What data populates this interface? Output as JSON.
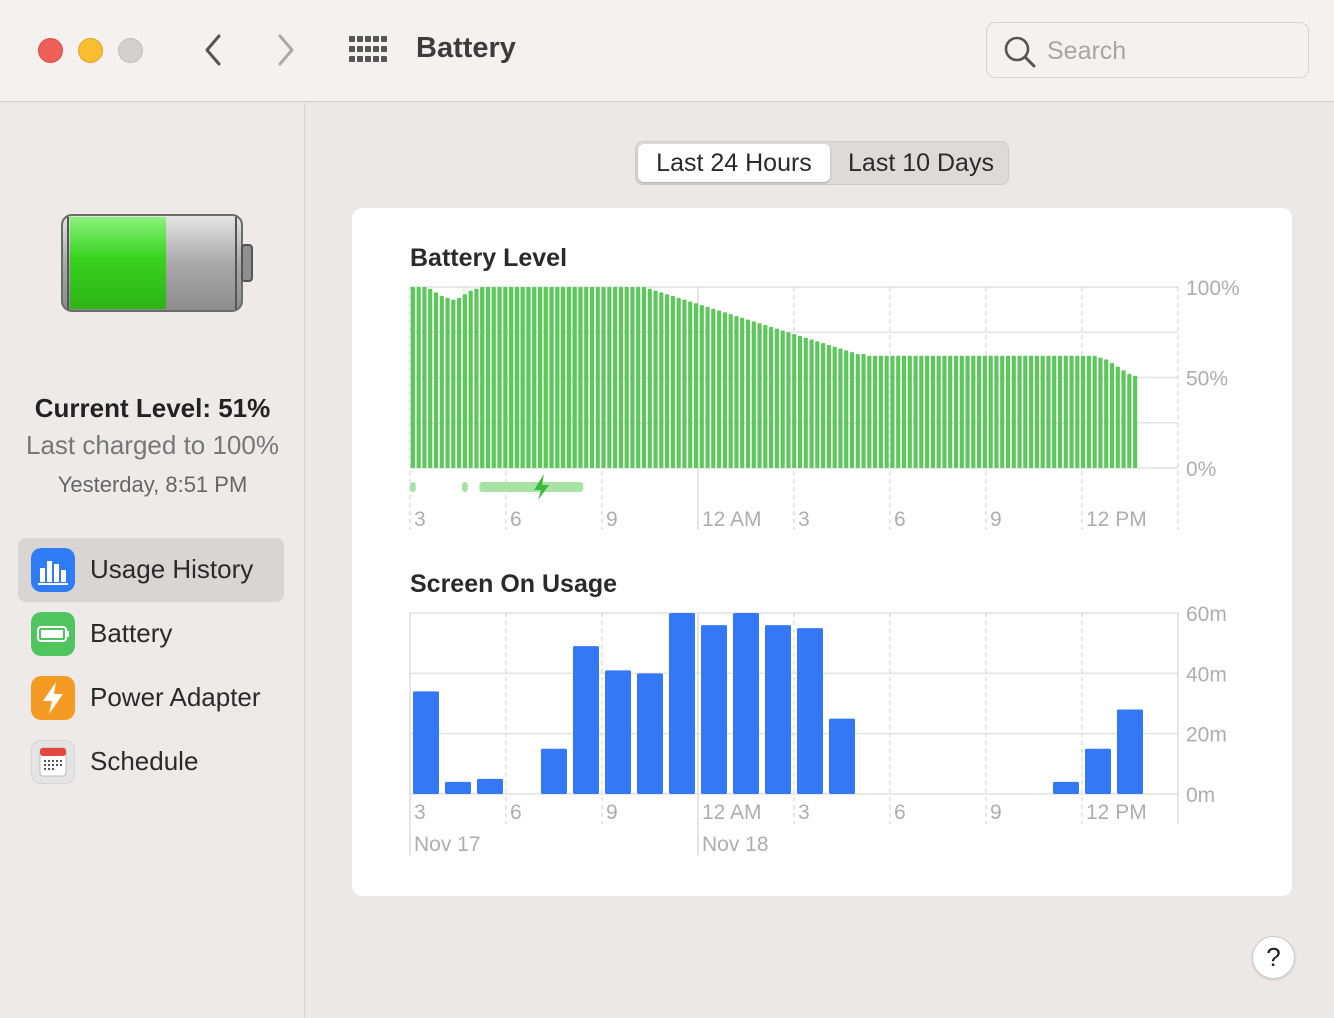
{
  "window": {
    "title": "Battery"
  },
  "search": {
    "placeholder": "Search"
  },
  "sidebar": {
    "current_level": "Current Level: 51%",
    "last_charged": "Last charged to 100%",
    "charged_time": "Yesterday, 8:51 PM",
    "battery_fill_fraction": 0.51,
    "items": [
      {
        "label": "Usage History",
        "icon": "bar-chart-icon",
        "color": "#2f7cf6",
        "active": true
      },
      {
        "label": "Battery",
        "icon": "battery-icon",
        "color": "#4fc45f",
        "active": false
      },
      {
        "label": "Power Adapter",
        "icon": "bolt-icon",
        "color": "#f59a23",
        "active": false
      },
      {
        "label": "Schedule",
        "icon": "calendar-icon",
        "color": "#e8e8e8",
        "active": false
      }
    ]
  },
  "tabs": [
    {
      "label": "Last 24 Hours",
      "selected": true
    },
    {
      "label": "Last 10 Days",
      "selected": false
    }
  ],
  "help_label": "?",
  "colors": {
    "battery_green": "#5cc85b",
    "charging_green": "#a7e4a4",
    "usage_blue": "#3478f6"
  },
  "chart_data": [
    {
      "type": "bar",
      "title": "Battery Level",
      "y_unit": "%",
      "ylim": [
        0,
        100
      ],
      "y_ticks": [
        "100%",
        "50%",
        "0%"
      ],
      "x_ticks": [
        "3",
        "6",
        "9",
        "12 AM",
        "3",
        "6",
        "9",
        "12 PM"
      ],
      "values": [
        100,
        100,
        100,
        99,
        97,
        95,
        94,
        93,
        94,
        96,
        98,
        99,
        100,
        100,
        100,
        100,
        100,
        100,
        100,
        100,
        100,
        100,
        100,
        100,
        100,
        100,
        100,
        100,
        100,
        100,
        100,
        100,
        100,
        100,
        100,
        100,
        100,
        100,
        100,
        100,
        100,
        99,
        98,
        97,
        96,
        95,
        94,
        93,
        92,
        91,
        90,
        89,
        88,
        87,
        86,
        85,
        84,
        83,
        82,
        81,
        80,
        79,
        78,
        77,
        76,
        75,
        74,
        73,
        72,
        71,
        70,
        69,
        68,
        67,
        66,
        65,
        64,
        63,
        63,
        62,
        62,
        62,
        62,
        62,
        62,
        62,
        62,
        62,
        62,
        62,
        62,
        62,
        62,
        62,
        62,
        62,
        62,
        62,
        62,
        62,
        62,
        62,
        62,
        62,
        62,
        62,
        62,
        62,
        62,
        62,
        62,
        62,
        62,
        62,
        62,
        62,
        62,
        62,
        62,
        61,
        60,
        58,
        56,
        54,
        52,
        51
      ],
      "charging_periods": [
        [
          0,
          1
        ],
        [
          9,
          10
        ],
        [
          12,
          30
        ]
      ]
    },
    {
      "type": "bar",
      "title": "Screen On Usage",
      "y_unit": "minutes",
      "ylim": [
        0,
        60
      ],
      "y_ticks": [
        "60m",
        "40m",
        "20m",
        "0m"
      ],
      "x_ticks": [
        "3",
        "6",
        "9",
        "12 AM",
        "3",
        "6",
        "9",
        "12 PM"
      ],
      "date_labels": [
        "Nov 17",
        "Nov 18"
      ],
      "values": [
        34,
        4,
        5,
        0,
        15,
        49,
        41,
        40,
        60,
        56,
        60,
        56,
        55,
        25,
        0,
        0,
        0,
        0,
        0,
        0,
        4,
        15,
        28
      ]
    }
  ]
}
